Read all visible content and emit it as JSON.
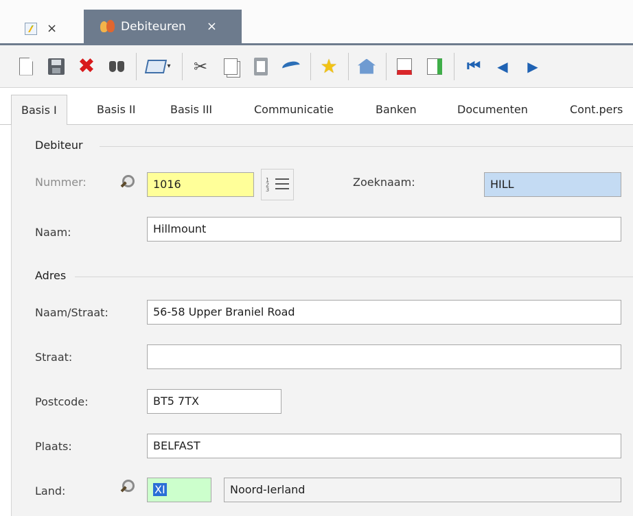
{
  "tabs": {
    "home_close": "×",
    "active_label": "Debiteuren",
    "active_close": "×"
  },
  "toolbar": {
    "icons": [
      "new-document-icon",
      "save-icon",
      "delete-icon",
      "search-binoculars-icon",
      "print-icon",
      "cut-icon",
      "copy-icon",
      "paste-icon",
      "undo-icon",
      "favorite-star-icon",
      "home-add-icon",
      "document-red-icon",
      "document-green-icon",
      "first-record-icon",
      "previous-record-icon",
      "next-record-icon"
    ],
    "print_dropdown": "▾",
    "nav_first": "⏮",
    "nav_prev": "◀",
    "nav_next": "▶"
  },
  "subtabs": [
    "Basis I",
    "Basis II",
    "Basis III",
    "Communicatie",
    "Banken",
    "Documenten",
    "Cont.pers"
  ],
  "debiteur": {
    "group_title": "Debiteur",
    "nummer_label": "Nummer:",
    "nummer_value": "1016",
    "zoeknaam_label": "Zoeknaam:",
    "zoeknaam_value": "HILL",
    "naam_label": "Naam:",
    "naam_value": "Hillmount"
  },
  "adres": {
    "group_title": "Adres",
    "naam_straat_label": "Naam/Straat:",
    "naam_straat_value": "56-58 Upper Braniel Road",
    "straat_label": "Straat:",
    "straat_value": "",
    "postcode_label": "Postcode:",
    "postcode_value": "BT5 7TX",
    "plaats_label": "Plaats:",
    "plaats_value": "BELFAST",
    "land_label": "Land:",
    "land_code": "XI",
    "land_name": "Noord-Ierland"
  },
  "colors": {
    "tab_active": "#6d7b8d",
    "nummer_bg": "#ffff99",
    "zoeknaam_bg": "#c4dbf3",
    "land_bg": "#ccffcc",
    "delete_red": "#d8191b",
    "nav_blue": "#1f62b3"
  }
}
